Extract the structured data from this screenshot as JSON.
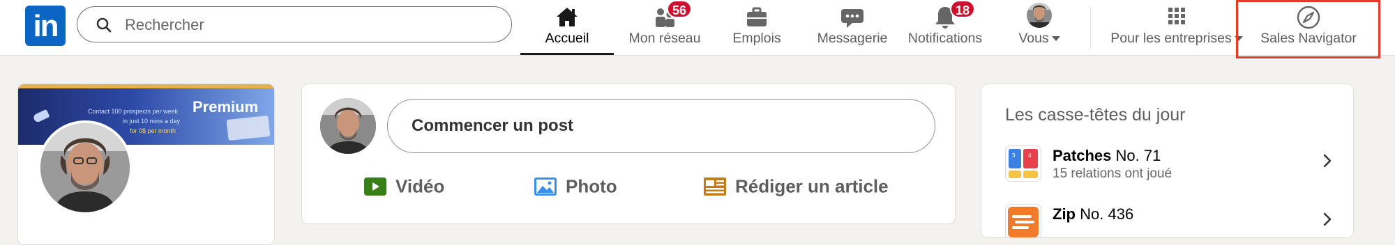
{
  "brand": {
    "logo_text": "in",
    "color": "#0a66c2"
  },
  "search": {
    "placeholder": "Rechercher"
  },
  "nav": {
    "home": {
      "label": "Accueil",
      "icon": "home-icon"
    },
    "network": {
      "label": "Mon réseau",
      "icon": "people-icon",
      "badge": "56"
    },
    "jobs": {
      "label": "Emplois",
      "icon": "briefcase-icon"
    },
    "messaging": {
      "label": "Messagerie",
      "icon": "chat-icon"
    },
    "notifications": {
      "label": "Notifications",
      "icon": "bell-icon",
      "badge": "18"
    },
    "me": {
      "label": "Vous",
      "icon": "avatar"
    },
    "business": {
      "label": "Pour les entreprises",
      "icon": "grid-icon"
    },
    "sales": {
      "label": "Sales Navigator",
      "icon": "compass-icon"
    }
  },
  "profile": {
    "banner_badge": "Premium",
    "banner_line1": "Contact 100 prospects per week",
    "banner_line2": "in just 10 mins a day",
    "banner_line3": "for 0$ per month"
  },
  "composer": {
    "prompt": "Commencer un post",
    "video": "Vidéo",
    "photo": "Photo",
    "article": "Rédiger un article"
  },
  "puzzles": {
    "title": "Les casse-têtes du jour",
    "items": [
      {
        "name": "Patches",
        "number": "No. 71",
        "subtitle": "15 relations ont joué"
      },
      {
        "name": "Zip",
        "number": "No. 436",
        "subtitle": ""
      }
    ]
  },
  "colors": {
    "accent": "#0a66c2",
    "badge": "#cb112d",
    "highlight": "#e53a24",
    "video": "#378018",
    "photo": "#378fe9",
    "article": "#c37d16"
  }
}
